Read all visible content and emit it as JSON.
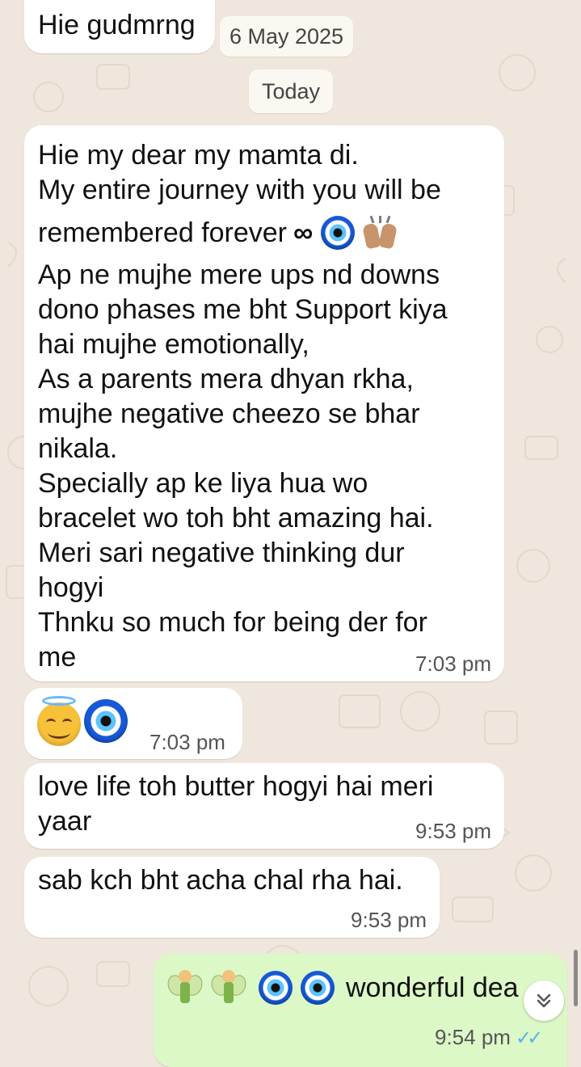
{
  "chat": {
    "date_chip": "6 May 2025",
    "today_chip": "Today",
    "messages": [
      {
        "text": "Hie gudmrng",
        "time": ""
      },
      {
        "line1": "Hie my dear my mamta di.",
        "line2": "My entire journey with you will be",
        "line3": "remembered forever",
        "rest": "Ap ne mujhe mere ups nd downs\ndono phases me bht Support kiya\nhai mujhe emotionally,\nAs a parents mera dhyan rkha,\nmujhe negative cheezo se bhar\nnikala.\nSpecially ap ke liya hua wo\nbracelet wo toh bht amazing hai.\nMeri sari negative thinking dur\nhogyi\nThnku so much for being der for\nme",
        "time": "7:03 pm",
        "emoji": [
          "infinity-icon",
          "evil-eye-icon",
          "raised-hands-icon"
        ]
      },
      {
        "emoji": [
          "smiling-face-with-halo-icon",
          "evil-eye-icon"
        ],
        "time": "7:03 pm"
      },
      {
        "text": "love life toh butter hogyi hai meri\nyaar",
        "time": "9:53 pm"
      },
      {
        "text": "sab kch bht acha chal rha hai.",
        "time": "9:53 pm"
      },
      {
        "text": "wonderful dea",
        "time": "9:54 pm",
        "emoji": [
          "fairy-icon",
          "fairy-icon",
          "evil-eye-icon",
          "evil-eye-icon"
        ],
        "status": "read-ticks-icon"
      }
    ]
  },
  "colors": {
    "background": "#efe7dd",
    "incoming_bubble": "#ffffff",
    "outgoing_bubble": "#dcf8c6",
    "read_ticks": "#4fb6ec"
  },
  "controls": {
    "scroll_down": "chevron-double-down-icon"
  }
}
